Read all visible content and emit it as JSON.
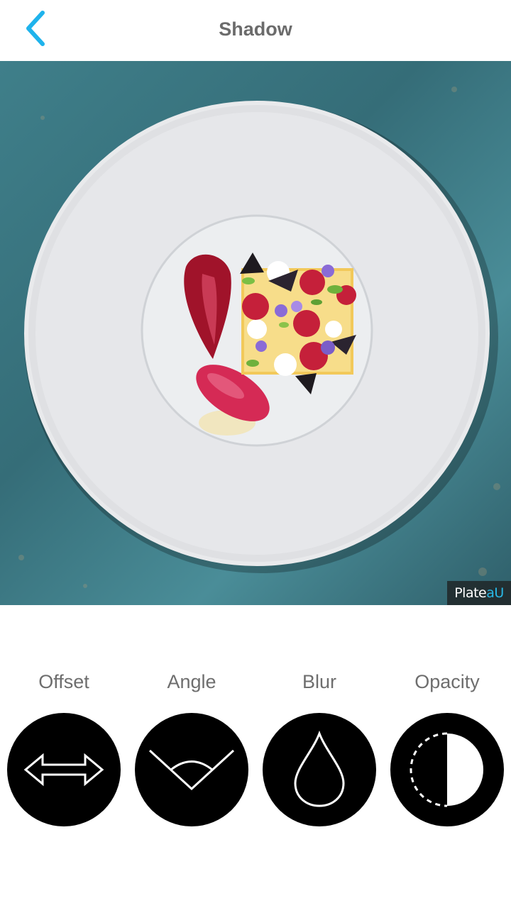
{
  "header": {
    "title": "Shadow",
    "back_icon": "chevron-left-icon",
    "accent_color": "#1fb3ec"
  },
  "photo": {
    "description_icon": "plated-dessert-image",
    "watermark_prefix": "Plate",
    "watermark_suffix": "aU"
  },
  "tools": [
    {
      "label": "Offset",
      "icon": "double-arrow-icon"
    },
    {
      "label": "Angle",
      "icon": "angle-icon"
    },
    {
      "label": "Blur",
      "icon": "drop-icon"
    },
    {
      "label": "Opacity",
      "icon": "half-circle-icon"
    }
  ]
}
